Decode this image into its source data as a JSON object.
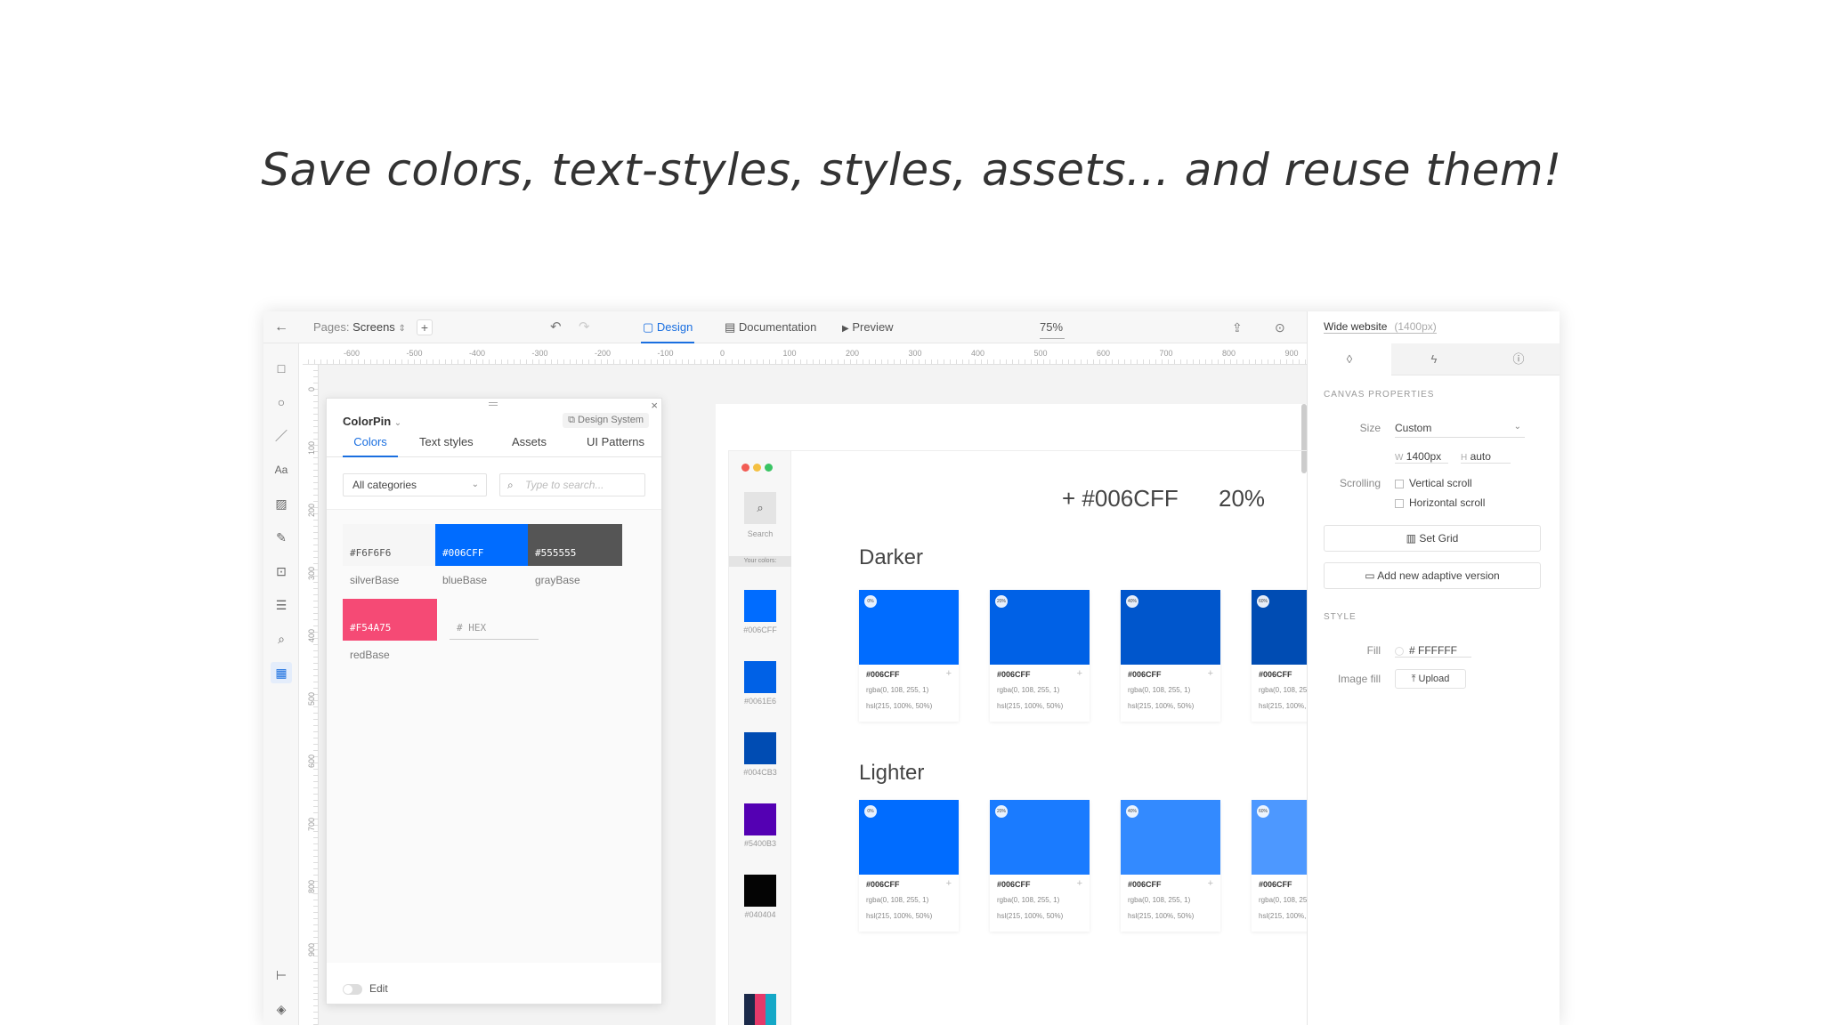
{
  "headline": "Save colors, text-styles, styles, assets... and reuse them!",
  "topbar": {
    "back_icon": "arrow-left-icon",
    "pages_label": "Pages:",
    "pages_value": "Screens",
    "add_page": "+",
    "undo_icon": "undo-icon",
    "redo_icon": "redo-icon",
    "tabs": [
      "Design",
      "Documentation",
      "Preview"
    ],
    "zoom": "75%",
    "share_icon": "share-icon",
    "check_icon": "check-circle-icon"
  },
  "ruler": {
    "h_labels": [
      "-600",
      "-500",
      "-400",
      "-300",
      "-200",
      "-100",
      "0",
      "100",
      "200",
      "300",
      "400",
      "500",
      "600",
      "700",
      "800",
      "900"
    ],
    "v_labels": [
      "0",
      "100",
      "200",
      "300",
      "400",
      "500",
      "600",
      "700",
      "800",
      "900"
    ]
  },
  "tools": [
    "rectangle-icon",
    "ellipse-icon",
    "line-icon",
    "text-icon",
    "image-icon",
    "pen-icon",
    "component-icon",
    "table-icon",
    "search-icon",
    "colorpin-icon",
    "tree-icon",
    "layers-icon"
  ],
  "colorpin": {
    "title": "ColorPin",
    "design_system": "Design System",
    "tabs": [
      "Colors",
      "Text styles",
      "Assets",
      "UI Patterns"
    ],
    "category": "All categories",
    "search_placeholder": "Type to search...",
    "swatches": [
      {
        "hex": "#F6F6F6",
        "name": "silverBase",
        "color": "#F6F6F6",
        "text": "#555555"
      },
      {
        "hex": "#006CFF",
        "name": "blueBase",
        "color": "#006CFF",
        "text": "#ffffff"
      },
      {
        "hex": "#555555",
        "name": "grayBase",
        "color": "#555555",
        "text": "#ffffff"
      },
      {
        "hex": "#F54A75",
        "name": "redBase",
        "color": "#F54A75",
        "text": "#ffffff"
      }
    ],
    "hex_placeholder": "HEX",
    "edit_label": "Edit"
  },
  "artboard": {
    "search_label": "Search",
    "your_colors": "Your colors:",
    "side_swatches": [
      {
        "hex": "#006CFF",
        "color": "#006CFF"
      },
      {
        "hex": "#0061E6",
        "color": "#0061E6"
      },
      {
        "hex": "#004CB3",
        "color": "#004CB3"
      },
      {
        "hex": "#5400B3",
        "color": "#5400B3"
      },
      {
        "hex": "#040404",
        "color": "#040404"
      }
    ],
    "main_hex": "+ #006CFF",
    "main_pct": "20%",
    "darker_title": "Darker",
    "lighter_title": "Lighter",
    "darker": [
      {
        "badge": "0%",
        "color": "#006CFF",
        "hex": "#006CFF",
        "rgba": "rgba(0, 108, 255, 1)",
        "hsl": "hsl(215, 100%, 50%)"
      },
      {
        "badge": "20%",
        "color": "#0061E6",
        "hex": "#006CFF",
        "rgba": "rgba(0, 108, 255, 1)",
        "hsl": "hsl(215, 100%, 50%)"
      },
      {
        "badge": "40%",
        "color": "#0056CC",
        "hex": "#006CFF",
        "rgba": "rgba(0, 108, 255, 1)",
        "hsl": "hsl(215, 100%, 50%)"
      },
      {
        "badge": "60%",
        "color": "#004CB3",
        "hex": "#006CFF",
        "rgba": "rgba(0, 108, 25",
        "hsl": "hsl(215, 100%,"
      }
    ],
    "lighter": [
      {
        "badge": "0%",
        "color": "#006CFF",
        "hex": "#006CFF",
        "rgba": "rgba(0, 108, 255, 1)",
        "hsl": "hsl(215, 100%, 50%)"
      },
      {
        "badge": "20%",
        "color": "#1A7BFF",
        "hex": "#006CFF",
        "rgba": "rgba(0, 108, 255, 1)",
        "hsl": "hsl(215, 100%, 50%)"
      },
      {
        "badge": "40%",
        "color": "#338AFF",
        "hex": "#006CFF",
        "rgba": "rgba(0, 108, 255, 1)",
        "hsl": "hsl(215, 100%, 50%)"
      },
      {
        "badge": "60%",
        "color": "#4D98FF",
        "hex": "#006CFF",
        "rgba": "rgba(0, 108, 25",
        "hsl": "hsl(215, 100%,"
      }
    ]
  },
  "inspector": {
    "title": "Wide website",
    "title_sub": "(1400px)",
    "tabs": [
      "drop-icon",
      "bolt-icon",
      "info-icon"
    ],
    "canvas_properties": "CANVAS PROPERTIES",
    "size_label": "Size",
    "size_value": "Custom",
    "w_label": "W",
    "w_value": "1400px",
    "h_label": "H",
    "h_value": "auto",
    "scrolling_label": "Scrolling",
    "vertical_scroll": "Vertical scroll",
    "horizontal_scroll": "Horizontal scroll",
    "set_grid": "Set Grid",
    "add_adaptive": "Add new adaptive version",
    "style_label": "STYLE",
    "fill_label": "Fill",
    "fill_value": "# FFFFFF",
    "image_fill_label": "Image fill",
    "upload_label": "Upload"
  }
}
